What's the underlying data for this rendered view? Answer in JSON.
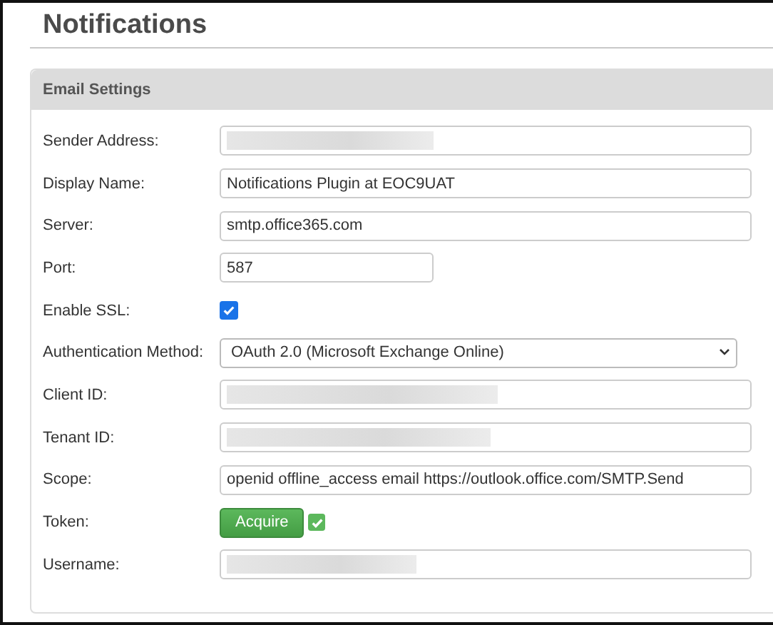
{
  "page": {
    "title": "Notifications"
  },
  "panel": {
    "title": "Email Settings",
    "fields": [
      {
        "label": "Sender Address:",
        "kind": "redacted"
      },
      {
        "label": "Display Name:",
        "kind": "text",
        "value": "Notifications Plugin at EOC9UAT"
      },
      {
        "label": "Server:",
        "kind": "text",
        "value": "smtp.office365.com"
      },
      {
        "label": "Port:",
        "kind": "number",
        "value": "587"
      },
      {
        "label": "Enable SSL:",
        "kind": "checkbox",
        "checked": true
      },
      {
        "label": "Authentication Method:",
        "kind": "select",
        "value": "OAuth 2.0 (Microsoft Exchange Online)"
      },
      {
        "label": "Client ID:",
        "kind": "redacted"
      },
      {
        "label": "Tenant ID:",
        "kind": "redacted"
      },
      {
        "label": "Scope:",
        "kind": "text",
        "value": "openid offline_access email https://outlook.office.com/SMTP.Send"
      },
      {
        "label": "Token:",
        "kind": "token",
        "button": "Acquire",
        "acquired": true
      },
      {
        "label": "Username:",
        "kind": "redacted"
      }
    ]
  }
}
